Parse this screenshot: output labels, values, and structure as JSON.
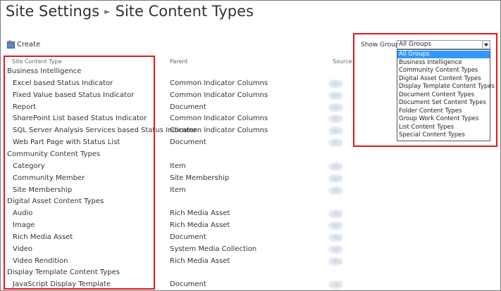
{
  "header": {
    "title": "Site Settings",
    "subtitle": "Site Content Types"
  },
  "toolbar": {
    "create_label": "Create"
  },
  "columns": {
    "type": "Site Content Type",
    "parent": "Parent",
    "source": "Source"
  },
  "rows": [
    {
      "kind": "group",
      "name": "Business Intelligence"
    },
    {
      "kind": "item",
      "name": "Excel based Status Indicator",
      "parent": "Common Indicator Columns"
    },
    {
      "kind": "item",
      "name": "Fixed Value based Status Indicator",
      "parent": "Common Indicator Columns"
    },
    {
      "kind": "item",
      "name": "Report",
      "parent": "Document"
    },
    {
      "kind": "item",
      "name": "SharePoint List based Status Indicator",
      "parent": "Common Indicator Columns"
    },
    {
      "kind": "item",
      "name": "SQL Server Analysis Services based Status Indicator",
      "parent": "Common Indicator Columns"
    },
    {
      "kind": "item",
      "name": "Web Part Page with Status List",
      "parent": "Document"
    },
    {
      "kind": "group",
      "name": "Community Content Types"
    },
    {
      "kind": "item",
      "name": "Category",
      "parent": "Item"
    },
    {
      "kind": "item",
      "name": "Community Member",
      "parent": "Site Membership"
    },
    {
      "kind": "item",
      "name": "Site Membership",
      "parent": "Item"
    },
    {
      "kind": "group",
      "name": "Digital Asset Content Types"
    },
    {
      "kind": "item",
      "name": "Audio",
      "parent": "Rich Media Asset"
    },
    {
      "kind": "item",
      "name": "Image",
      "parent": "Rich Media Asset"
    },
    {
      "kind": "item",
      "name": "Rich Media Asset",
      "parent": "Document"
    },
    {
      "kind": "item",
      "name": "Video",
      "parent": "System Media Collection"
    },
    {
      "kind": "item",
      "name": "Video Rendition",
      "parent": "Rich Media Asset"
    },
    {
      "kind": "group",
      "name": "Display Template Content Types"
    },
    {
      "kind": "item",
      "name": "JavaScript Display Template",
      "parent": "Document"
    }
  ],
  "show_group": {
    "label": "Show Group:",
    "selected": "All Groups",
    "options": [
      "All Groups",
      "Business Intelligence",
      "Community Content Types",
      "Digital Asset Content Types",
      "Display Template Content Types",
      "Document Content Types",
      "Document Set Content Types",
      "Folder Content Types",
      "Group Work Content Types",
      "List Content Types",
      "Special Content Types"
    ]
  },
  "colors": {
    "highlight": "#e2191b",
    "selected_option": "#3399ff"
  }
}
